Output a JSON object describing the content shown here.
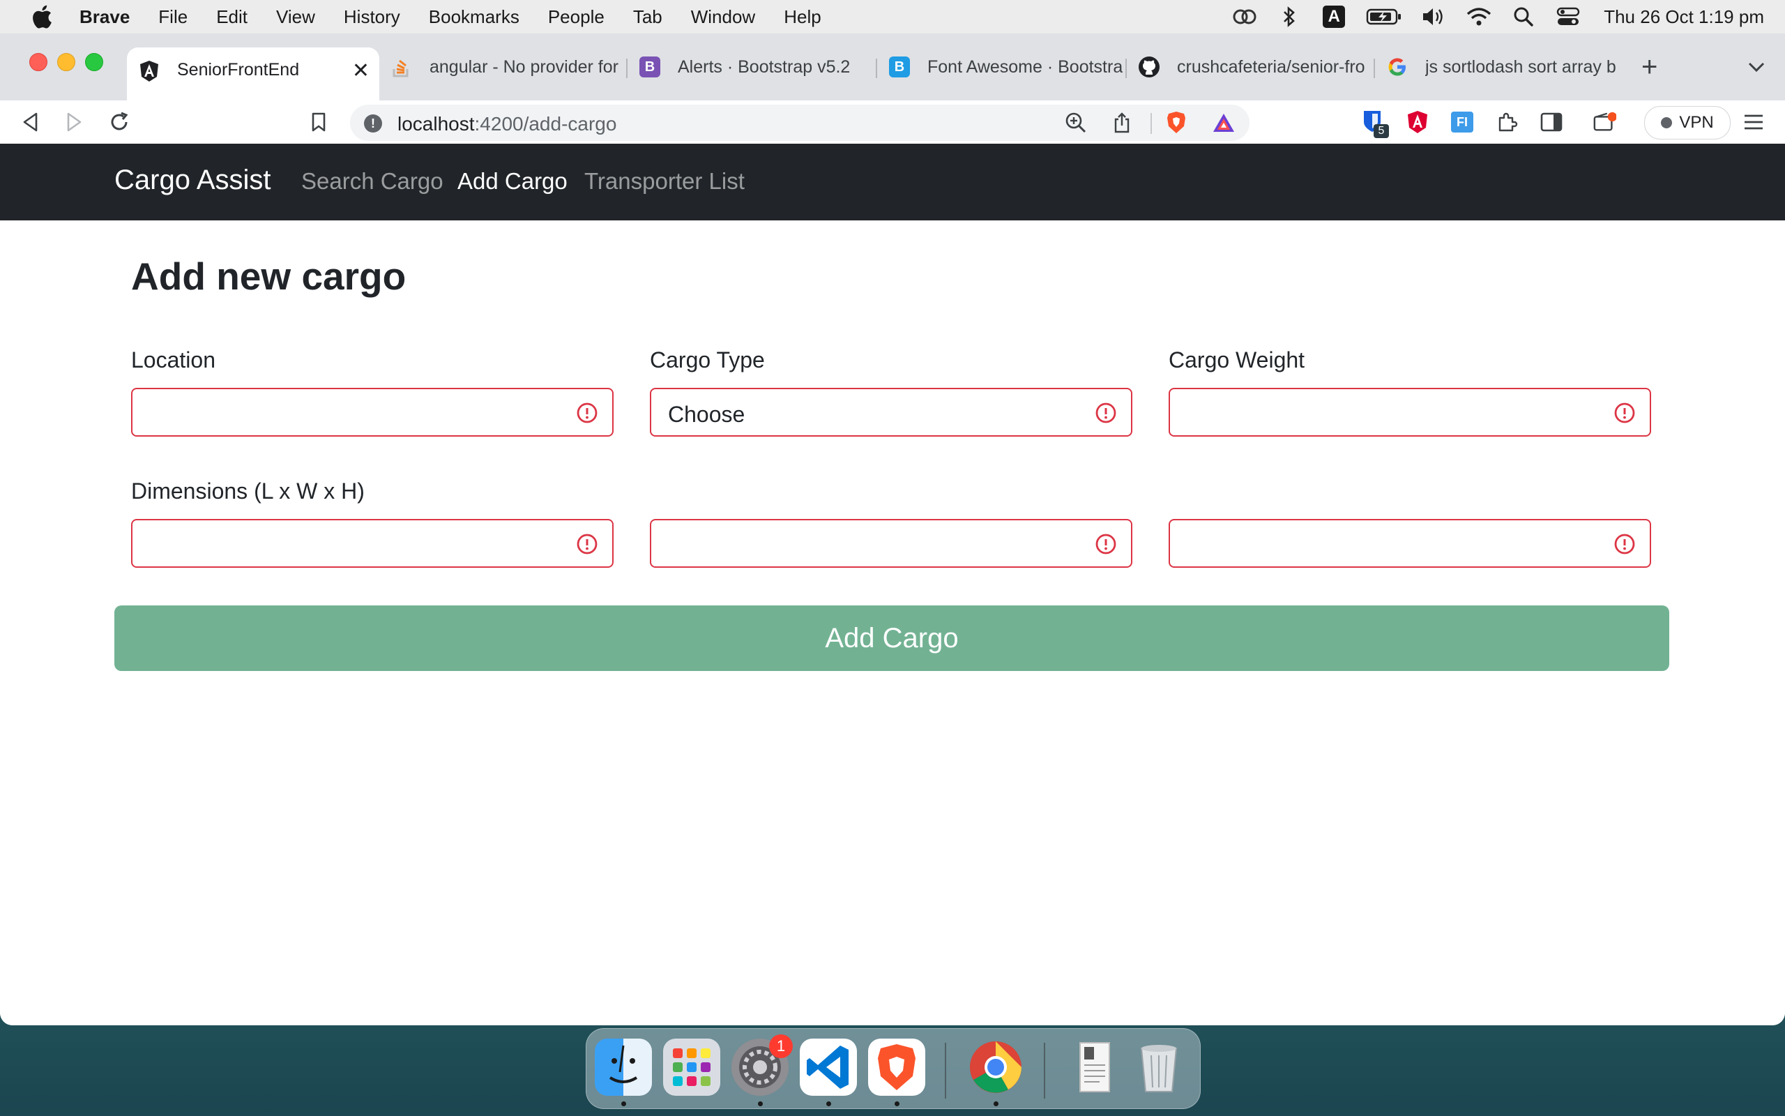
{
  "menubar": {
    "app_name": "Brave",
    "items": [
      "File",
      "Edit",
      "View",
      "History",
      "Bookmarks",
      "People",
      "Tab",
      "Window",
      "Help"
    ],
    "clock": "Thu 26 Oct  1:19 pm",
    "status_icons": [
      "creative-cloud-icon",
      "bluetooth-icon",
      "input-source-icon",
      "battery-icon",
      "volume-icon",
      "wifi-icon",
      "spotlight-search-icon",
      "control-center-icon"
    ],
    "input_source_letter": "A"
  },
  "tabs": [
    {
      "title": "SeniorFrontEnd",
      "icon": "angular-icon",
      "active": true
    },
    {
      "title": "angular - No provider for",
      "icon": "stackoverflow-icon",
      "active": false
    },
    {
      "title": "Alerts · Bootstrap v5.2",
      "icon": "bootstrap-icon",
      "active": false
    },
    {
      "title": "Font Awesome · Bootstra",
      "icon": "bootstrap-icon",
      "active": false
    },
    {
      "title": "crushcafeteria/senior-fro",
      "icon": "github-icon",
      "active": false
    },
    {
      "title": "js sortlodash sort array b",
      "icon": "google-icon",
      "active": false
    }
  ],
  "tab_close_glyph": "✕",
  "new_tab_glyph": "+",
  "address_bar": {
    "host": "localhost",
    "path": ":4200/add-cargo"
  },
  "extensions": {
    "bitwarden_badge": "5",
    "vpn_label": "VPN"
  },
  "app": {
    "brand": "Cargo Assist",
    "nav": [
      {
        "label": "Search Cargo",
        "active": false
      },
      {
        "label": "Add Cargo",
        "active": true
      },
      {
        "label": "Transporter List",
        "active": false
      }
    ],
    "title": "Add new cargo",
    "labels": {
      "location": "Location",
      "cargo_type": "Cargo Type",
      "cargo_weight": "Cargo Weight",
      "dimensions": "Dimensions (L x W x H)"
    },
    "fields": {
      "location": "",
      "cargo_type": "Choose",
      "cargo_weight": "",
      "length": "",
      "width": "",
      "height": ""
    },
    "validation_color": "#dc3545",
    "submit_label": "Add Cargo",
    "submit_color": "#72b293"
  },
  "dock": {
    "apps": [
      "finder-icon",
      "launchpad-icon",
      "system-settings-icon",
      "vscode-icon",
      "brave-icon",
      "chrome-icon",
      "document-icon",
      "trash-icon"
    ],
    "settings_badge": "1"
  }
}
